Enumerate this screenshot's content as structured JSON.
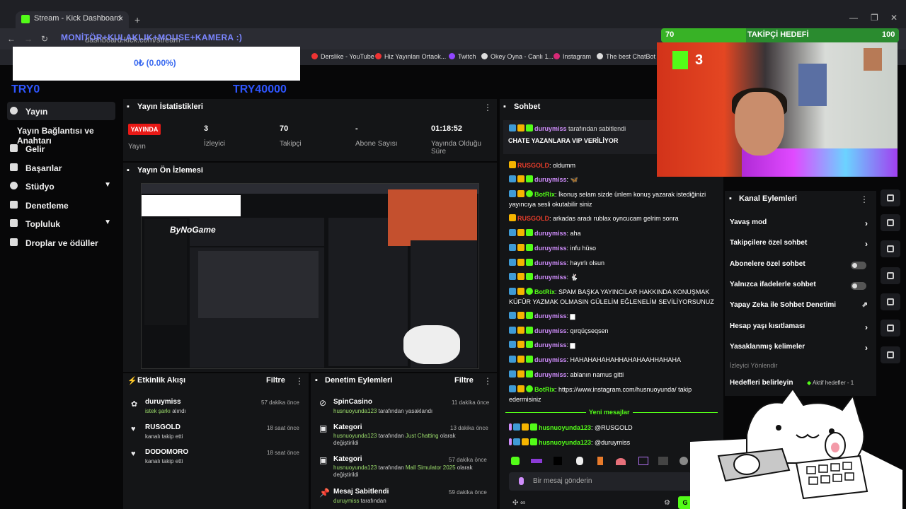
{
  "browser": {
    "tab_title": "Stream - Kick Dashboard",
    "url": "dashboard.kick.com/stream",
    "bookmarks": [
      "Derslike - YouTube",
      "Hiz Yayınları Ortaok...",
      "Twitch",
      "Okey Oyna - Canlı 1...",
      "Instagram",
      "The best ChatBot an..."
    ]
  },
  "overlay": {
    "goal_text": "MONİTÖR+KULAKLIK+MOUSE+KAMERA :)",
    "amount": "0₺ (0.00%)",
    "left": "TRY0",
    "right": "TRY40000",
    "followers_goal_label": "TAKİPÇİ HEDEFİ",
    "followers_current": "70",
    "followers_target": "100",
    "cam_badge": "3"
  },
  "sidebar": {
    "items": [
      {
        "label": "Yayın",
        "active": true
      },
      {
        "label": "Yayın Bağlantısı ve Anahtarı"
      },
      {
        "label": "Gelir"
      },
      {
        "label": "Başarılar"
      },
      {
        "label": "Stüdyo"
      },
      {
        "label": "Denetleme"
      },
      {
        "label": "Topluluk"
      },
      {
        "label": "Droplar ve ödüller"
      }
    ]
  },
  "stats": {
    "title": "Yayın İstatistikleri",
    "live": "YAYINDA",
    "live_caption": "Yayın",
    "items": [
      {
        "value": "3",
        "label": "İzleyici"
      },
      {
        "value": "70",
        "label": "Takipçi"
      },
      {
        "value": "-",
        "label": "Abone Sayısı"
      },
      {
        "value": "01:18:52",
        "label": "Yayında Olduğu Süre"
      }
    ]
  },
  "preview": {
    "title": "Yayın Ön İzlemesi",
    "watermark": "ByNoGame"
  },
  "activity": {
    "title": "Etkinlik Akışı",
    "filter": "Filtre",
    "items": [
      {
        "name": "duruymiss",
        "action_hl": "istek şarkı",
        "action": " alındı",
        "time": "57 dakika önce"
      },
      {
        "name": "RUSGOLD",
        "action_hl": "",
        "action": "kanalı takip etti",
        "time": "18 saat önce"
      },
      {
        "name": "DODOMORO",
        "action_hl": "",
        "action": "kanalı takip etti",
        "time": "18 saat önce"
      }
    ]
  },
  "moderation": {
    "title": "Denetim Eylemleri",
    "filter": "Filtre",
    "items": [
      {
        "name": "SpinCasino",
        "l1_hl": "husnuoyunda123",
        "l1": " tarafından yasaklandı",
        "l2_hl": "",
        "l2": "",
        "time": "11 dakika önce"
      },
      {
        "name": "Kategori",
        "l1_hl": "husnuoyunda123",
        "l1": " tarafından ",
        "l1b": "Just Chatting",
        "l1c": " olarak",
        "l2": "değiştirildi",
        "time": "13 dakika önce"
      },
      {
        "name": "Kategori",
        "l1_hl": "husnuoyunda123",
        "l1": " tarafından ",
        "l1b": "Mall Simulator 2025",
        "l1c": " olarak",
        "l2": "değiştirildi",
        "time": "57 dakika önce"
      },
      {
        "name": "Mesaj Sabitlendi",
        "l1_hl": "duruymiss",
        "l1": " tarafından",
        "time": "59 dakika önce"
      }
    ]
  },
  "chat": {
    "title": "Sohbet",
    "pinned_by": "duruymiss",
    "pinned_suffix": " tarafından sabitlendi",
    "pinned_msg": "CHATE YAZANLARA VIP VERİLİYOR",
    "messages": [
      {
        "user": "RUSGOLD",
        "cls": "u-rus",
        "text": ": oldumm"
      },
      {
        "user": "duruymiss",
        "cls": "u-duruy",
        "text": ": 🦋"
      },
      {
        "user": "BotRix",
        "cls": "u-bot",
        "text": ": İkonuş selam sizde ünlem konuş yazarak istediğinizi yayıncıya sesli okutabilir siniz"
      },
      {
        "user": "RUSGOLD",
        "cls": "u-rus",
        "text": ": arkadas aradı rublax oyncucam gelrim sonra"
      },
      {
        "user": "duruymiss",
        "cls": "u-duruy",
        "text": ": aha"
      },
      {
        "user": "duruymiss",
        "cls": "u-duruy",
        "text": ": infu hüso"
      },
      {
        "user": "duruymiss",
        "cls": "u-duruy",
        "text": ": hayırlı olsun"
      },
      {
        "user": "duruymiss",
        "cls": "u-duruy",
        "text": ": 🐇"
      },
      {
        "user": "BotRix",
        "cls": "u-bot",
        "text": ": SPAM BAŞKA YAYINCILAR HAKKINDA KONUŞMAK KÜFÜR YAZMAK OLMASIN GÜLELİM EĞLENELİM SEVİLİYORSUNUZ"
      },
      {
        "user": "duruymiss",
        "cls": "u-duruy",
        "text": ": ▆"
      },
      {
        "user": "duruymiss",
        "cls": "u-duruy",
        "text": ": qırqüçseqsen"
      },
      {
        "user": "duruymiss",
        "cls": "u-duruy",
        "text": ": ▆"
      },
      {
        "user": "duruymiss",
        "cls": "u-duruy",
        "text": ": HAHAHAHAHAHHAHAHAAHHAHAHA"
      },
      {
        "user": "duruymiss",
        "cls": "u-duruy",
        "text": ": ablanın namus gitti"
      },
      {
        "user": "BotRix",
        "cls": "u-bot",
        "text": ": https://www.instagram.com/husnuoyunda/ takip edermisiniz"
      }
    ],
    "new_messages": "Yeni mesajlar",
    "recent": [
      {
        "user": "husnuoyunda123",
        "text": ": @RUSGOLD"
      },
      {
        "user": "husnuoyunda123",
        "text": ": @duruymiss"
      }
    ],
    "input_placeholder": "Bir mesaj gönderin",
    "send": "G"
  },
  "channel_actions": {
    "title": "Kanal Eylemleri",
    "items": [
      {
        "label": "Yavaş mod",
        "kind": "arrow"
      },
      {
        "label": "Takipçilere özel sohbet",
        "kind": "arrow"
      },
      {
        "label": "Abonelere özel sohbet",
        "kind": "toggle"
      },
      {
        "label": "Yalnızca ifadelerle sohbet",
        "kind": "toggle"
      },
      {
        "label": "Yapay Zeka ile Sohbet Denetimi",
        "kind": "ext"
      },
      {
        "label": "Hesap yaşı kısıtlaması",
        "kind": "arrow"
      },
      {
        "label": "Yasaklanmış kelimeler",
        "kind": "arrow"
      }
    ],
    "section": "İzleyici Yönlendir",
    "goals_label": "Hedefleri belirleyin",
    "goals_status": "Aktif hedefler - 1"
  },
  "colors": {
    "kick_green": "#53fc18",
    "live_red": "#e91916",
    "panel": "#141517"
  }
}
